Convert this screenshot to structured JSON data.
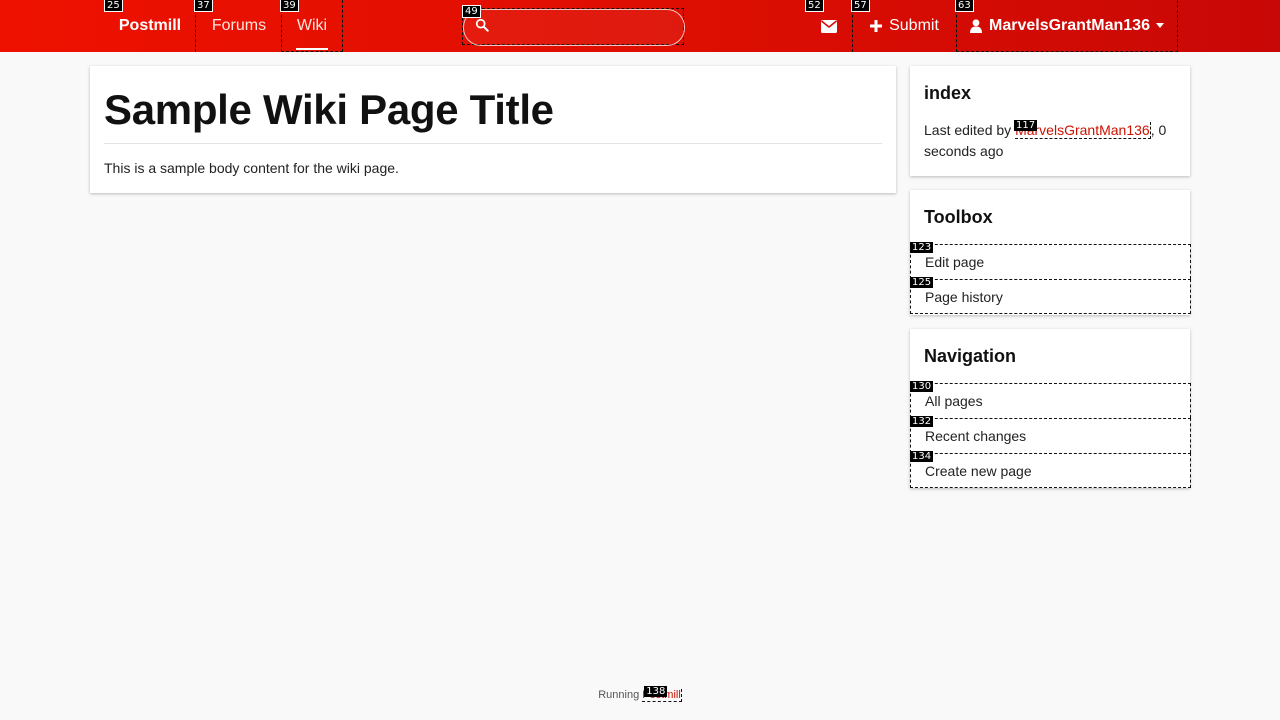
{
  "navbar": {
    "brand": "Postmill",
    "forums": "Forums",
    "wiki": "Wiki",
    "search_placeholder": "",
    "submit": "Submit",
    "username": "MarvelsGrantMan136",
    "icons": {
      "search": "search-icon",
      "mail": "envelope-icon",
      "submit": "plus-icon",
      "user": "user-icon"
    }
  },
  "badges": {
    "brand": "25",
    "forums": "37",
    "wiki": "39",
    "search": "49",
    "mail": "52",
    "submit": "57",
    "user": "63",
    "author": "117",
    "edit": "123",
    "history": "125",
    "all_pages": "130",
    "recent": "132",
    "create": "134",
    "footer": "138"
  },
  "main": {
    "title": "Sample Wiki Page Title",
    "body": "This is a sample body content for the wiki page."
  },
  "sidebar": {
    "index": {
      "title": "index",
      "edited_prefix": "Last edited by ",
      "author": "MarvelsGrantMan136",
      "edited_suffix": ", 0 seconds ago"
    },
    "toolbox": {
      "title": "Toolbox",
      "items": [
        {
          "label": "Edit page"
        },
        {
          "label": "Page history"
        }
      ]
    },
    "navigation": {
      "title": "Navigation",
      "items": [
        {
          "label": "All pages"
        },
        {
          "label": "Recent changes"
        },
        {
          "label": "Create new page"
        }
      ]
    }
  },
  "footer": {
    "prefix": "Running ",
    "link": "Postmill"
  },
  "colors": {
    "navbar": "#e40c02",
    "accent_link": "#cc1100",
    "page_bg": "#f9f9f9"
  }
}
